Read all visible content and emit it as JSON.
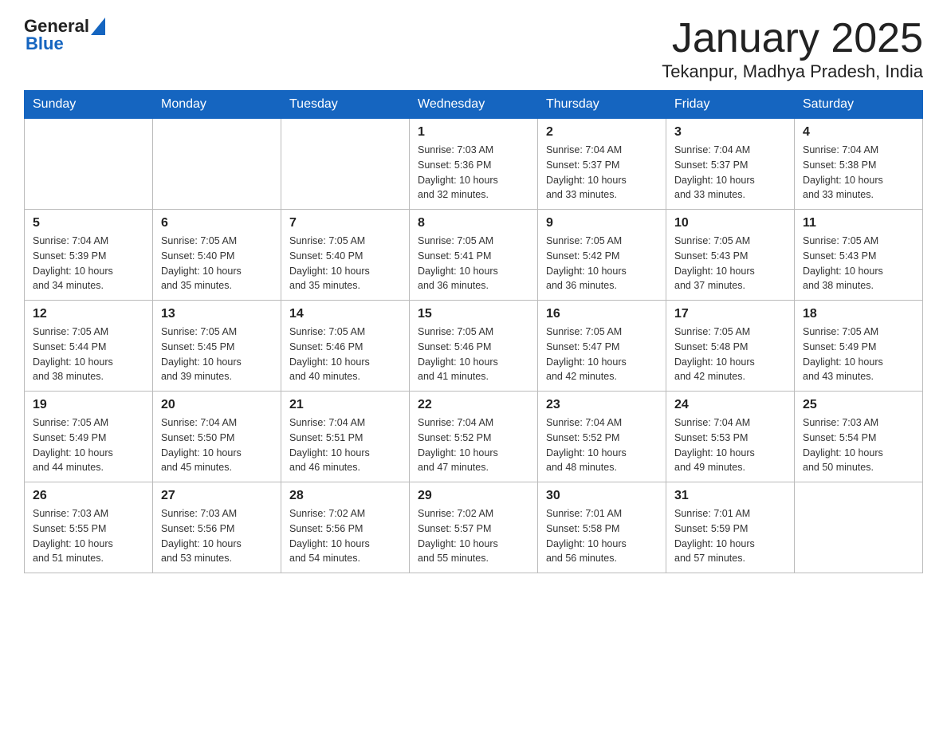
{
  "header": {
    "logo": {
      "general": "General",
      "blue": "Blue"
    },
    "title": "January 2025",
    "location": "Tekanpur, Madhya Pradesh, India"
  },
  "weekdays": [
    "Sunday",
    "Monday",
    "Tuesday",
    "Wednesday",
    "Thursday",
    "Friday",
    "Saturday"
  ],
  "weeks": [
    [
      {
        "day": "",
        "info": ""
      },
      {
        "day": "",
        "info": ""
      },
      {
        "day": "",
        "info": ""
      },
      {
        "day": "1",
        "info": "Sunrise: 7:03 AM\nSunset: 5:36 PM\nDaylight: 10 hours\nand 32 minutes."
      },
      {
        "day": "2",
        "info": "Sunrise: 7:04 AM\nSunset: 5:37 PM\nDaylight: 10 hours\nand 33 minutes."
      },
      {
        "day": "3",
        "info": "Sunrise: 7:04 AM\nSunset: 5:37 PM\nDaylight: 10 hours\nand 33 minutes."
      },
      {
        "day": "4",
        "info": "Sunrise: 7:04 AM\nSunset: 5:38 PM\nDaylight: 10 hours\nand 33 minutes."
      }
    ],
    [
      {
        "day": "5",
        "info": "Sunrise: 7:04 AM\nSunset: 5:39 PM\nDaylight: 10 hours\nand 34 minutes."
      },
      {
        "day": "6",
        "info": "Sunrise: 7:05 AM\nSunset: 5:40 PM\nDaylight: 10 hours\nand 35 minutes."
      },
      {
        "day": "7",
        "info": "Sunrise: 7:05 AM\nSunset: 5:40 PM\nDaylight: 10 hours\nand 35 minutes."
      },
      {
        "day": "8",
        "info": "Sunrise: 7:05 AM\nSunset: 5:41 PM\nDaylight: 10 hours\nand 36 minutes."
      },
      {
        "day": "9",
        "info": "Sunrise: 7:05 AM\nSunset: 5:42 PM\nDaylight: 10 hours\nand 36 minutes."
      },
      {
        "day": "10",
        "info": "Sunrise: 7:05 AM\nSunset: 5:43 PM\nDaylight: 10 hours\nand 37 minutes."
      },
      {
        "day": "11",
        "info": "Sunrise: 7:05 AM\nSunset: 5:43 PM\nDaylight: 10 hours\nand 38 minutes."
      }
    ],
    [
      {
        "day": "12",
        "info": "Sunrise: 7:05 AM\nSunset: 5:44 PM\nDaylight: 10 hours\nand 38 minutes."
      },
      {
        "day": "13",
        "info": "Sunrise: 7:05 AM\nSunset: 5:45 PM\nDaylight: 10 hours\nand 39 minutes."
      },
      {
        "day": "14",
        "info": "Sunrise: 7:05 AM\nSunset: 5:46 PM\nDaylight: 10 hours\nand 40 minutes."
      },
      {
        "day": "15",
        "info": "Sunrise: 7:05 AM\nSunset: 5:46 PM\nDaylight: 10 hours\nand 41 minutes."
      },
      {
        "day": "16",
        "info": "Sunrise: 7:05 AM\nSunset: 5:47 PM\nDaylight: 10 hours\nand 42 minutes."
      },
      {
        "day": "17",
        "info": "Sunrise: 7:05 AM\nSunset: 5:48 PM\nDaylight: 10 hours\nand 42 minutes."
      },
      {
        "day": "18",
        "info": "Sunrise: 7:05 AM\nSunset: 5:49 PM\nDaylight: 10 hours\nand 43 minutes."
      }
    ],
    [
      {
        "day": "19",
        "info": "Sunrise: 7:05 AM\nSunset: 5:49 PM\nDaylight: 10 hours\nand 44 minutes."
      },
      {
        "day": "20",
        "info": "Sunrise: 7:04 AM\nSunset: 5:50 PM\nDaylight: 10 hours\nand 45 minutes."
      },
      {
        "day": "21",
        "info": "Sunrise: 7:04 AM\nSunset: 5:51 PM\nDaylight: 10 hours\nand 46 minutes."
      },
      {
        "day": "22",
        "info": "Sunrise: 7:04 AM\nSunset: 5:52 PM\nDaylight: 10 hours\nand 47 minutes."
      },
      {
        "day": "23",
        "info": "Sunrise: 7:04 AM\nSunset: 5:52 PM\nDaylight: 10 hours\nand 48 minutes."
      },
      {
        "day": "24",
        "info": "Sunrise: 7:04 AM\nSunset: 5:53 PM\nDaylight: 10 hours\nand 49 minutes."
      },
      {
        "day": "25",
        "info": "Sunrise: 7:03 AM\nSunset: 5:54 PM\nDaylight: 10 hours\nand 50 minutes."
      }
    ],
    [
      {
        "day": "26",
        "info": "Sunrise: 7:03 AM\nSunset: 5:55 PM\nDaylight: 10 hours\nand 51 minutes."
      },
      {
        "day": "27",
        "info": "Sunrise: 7:03 AM\nSunset: 5:56 PM\nDaylight: 10 hours\nand 53 minutes."
      },
      {
        "day": "28",
        "info": "Sunrise: 7:02 AM\nSunset: 5:56 PM\nDaylight: 10 hours\nand 54 minutes."
      },
      {
        "day": "29",
        "info": "Sunrise: 7:02 AM\nSunset: 5:57 PM\nDaylight: 10 hours\nand 55 minutes."
      },
      {
        "day": "30",
        "info": "Sunrise: 7:01 AM\nSunset: 5:58 PM\nDaylight: 10 hours\nand 56 minutes."
      },
      {
        "day": "31",
        "info": "Sunrise: 7:01 AM\nSunset: 5:59 PM\nDaylight: 10 hours\nand 57 minutes."
      },
      {
        "day": "",
        "info": ""
      }
    ]
  ]
}
